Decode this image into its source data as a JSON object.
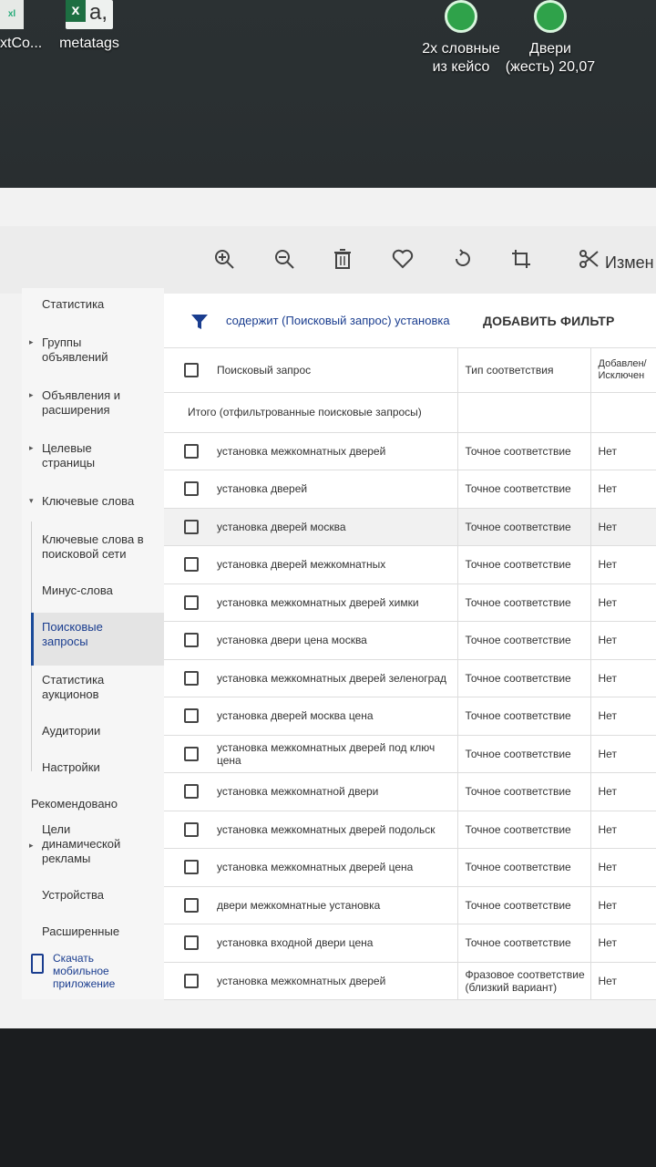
{
  "desktop": {
    "icons": [
      {
        "label": "xtCo...",
        "name": "desktop-icon-partial"
      },
      {
        "label": "metatags",
        "name": "desktop-icon-metatags"
      },
      {
        "label": "2х словные\nиз кейсо",
        "name": "desktop-icon-2x-slovnye"
      },
      {
        "label": "Двери\n(жесть) 20,07",
        "name": "desktop-icon-dveri"
      }
    ]
  },
  "toolbar": {
    "icons": [
      "zoom-in-icon",
      "zoom-out-icon",
      "delete-icon",
      "heart-icon",
      "rotate-icon",
      "crop-icon",
      "edit-icon"
    ],
    "edit_label": "Измен"
  },
  "sidebar": {
    "items": [
      {
        "label": "Статистика",
        "arrow": ""
      },
      {
        "label": "Группы объявлений",
        "arrow": "▸"
      },
      {
        "label": "Объявления и расширения",
        "arrow": "▸"
      },
      {
        "label": "Целевые страницы",
        "arrow": "▸"
      },
      {
        "label": "Ключевые слова",
        "arrow": "▾"
      },
      {
        "label": "Ключевые слова в поисковой сети",
        "arrow": ""
      },
      {
        "label": "Минус-слова",
        "arrow": ""
      },
      {
        "label": "Поисковые запросы",
        "arrow": ""
      },
      {
        "label": "Статистика аукционов",
        "arrow": ""
      },
      {
        "label": "Аудитории",
        "arrow": ""
      },
      {
        "label": "Настройки",
        "arrow": ""
      }
    ],
    "recommended_header": "Рекомендовано",
    "recommended": [
      {
        "label": "Цели динамической рекламы",
        "arrow": "▸"
      },
      {
        "label": "Устройства",
        "arrow": ""
      },
      {
        "label": "Расширенные",
        "arrow": ""
      }
    ],
    "app_download": "Скачать мобильное приложение"
  },
  "filter": {
    "text": "содержит (Поисковый запрос) установка",
    "add_label": "ДОБАВИТЬ ФИЛЬТР"
  },
  "table": {
    "headers": [
      "Поисковый запрос",
      "Тип соответствия",
      "Добавлен/Исключен"
    ],
    "total_label": "Итого (отфильтрованные поисковые запросы)",
    "rows": [
      {
        "query": "установка межкомнатных дверей",
        "match": "Точное соответствие",
        "added": "Нет"
      },
      {
        "query": "установка дверей",
        "match": "Точное соответствие",
        "added": "Нет"
      },
      {
        "query": "установка дверей москва",
        "match": "Точное соответствие",
        "added": "Нет"
      },
      {
        "query": "установка дверей межкомнатных",
        "match": "Точное соответствие",
        "added": "Нет"
      },
      {
        "query": "установка межкомнатных дверей химки",
        "match": "Точное соответствие",
        "added": "Нет"
      },
      {
        "query": "установка двери цена москва",
        "match": "Точное соответствие",
        "added": "Нет"
      },
      {
        "query": "установка межкомнатных дверей зеленоград",
        "match": "Точное соответствие",
        "added": "Нет"
      },
      {
        "query": "установка дверей москва цена",
        "match": "Точное соответствие",
        "added": "Нет"
      },
      {
        "query": "установка межкомнатных дверей под ключ цена",
        "match": "Точное соответствие",
        "added": "Нет"
      },
      {
        "query": "установка межкомнатной двери",
        "match": "Точное соответствие",
        "added": "Нет"
      },
      {
        "query": "установка межкомнатных дверей подольск",
        "match": "Точное соответствие",
        "added": "Нет"
      },
      {
        "query": "установка межкомнатных дверей цена",
        "match": "Точное соответствие",
        "added": "Нет"
      },
      {
        "query": "двери межкомнатные установка",
        "match": "Точное соответствие",
        "added": "Нет"
      },
      {
        "query": "установка входной двери цена",
        "match": "Точное соответствие",
        "added": "Нет"
      },
      {
        "query": "установка межкомнатных дверей",
        "match": "Фразовое соответствие (близкий вариант)",
        "added": "Нет"
      }
    ]
  }
}
